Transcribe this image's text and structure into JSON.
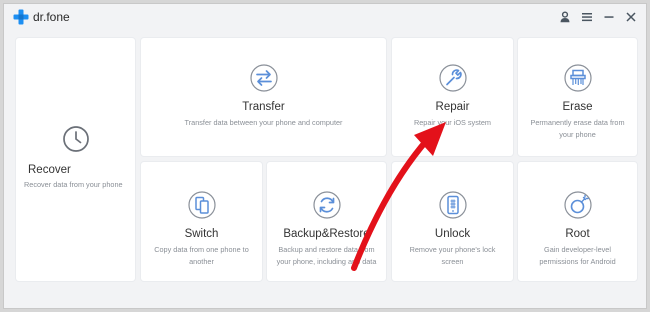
{
  "app": {
    "name": "dr.fone"
  },
  "colors": {
    "brand": "#1d8ff2",
    "icon": "#6b7078",
    "annotation_arrow": "#e3111a"
  },
  "icons": {
    "logo": "plus-cross-logo",
    "account": "user-icon",
    "menu": "hamburger-icon",
    "minimize": "minimize-icon",
    "close": "close-icon"
  },
  "tiles": {
    "recover": {
      "title": "Recover",
      "desc": "Recover data from your phone",
      "icon": "clock-icon"
    },
    "transfer": {
      "title": "Transfer",
      "desc": "Transfer data between your phone and computer",
      "icon": "swap-arrows-icon"
    },
    "repair": {
      "title": "Repair",
      "desc": "Repair your iOS system",
      "icon": "wrench-icon"
    },
    "erase": {
      "title": "Erase",
      "desc1": "Permanently erase data from",
      "desc2": "your phone",
      "icon": "shredder-icon"
    },
    "switch": {
      "title": "Switch",
      "desc1": "Copy data from one phone to",
      "desc2": "another",
      "icon": "phones-icon"
    },
    "backup": {
      "title": "Backup&Restore",
      "desc1": "Backup and restore data from",
      "desc2": "your phone, including app data",
      "icon": "refresh-icon"
    },
    "unlock": {
      "title": "Unlock",
      "desc1": "Remove your phone's lock",
      "desc2": "screen",
      "icon": "phone-keypad-icon"
    },
    "root": {
      "title": "Root",
      "desc1": "Gain developer-level",
      "desc2": "permissions for Android",
      "icon": "root-bomb-icon"
    }
  }
}
